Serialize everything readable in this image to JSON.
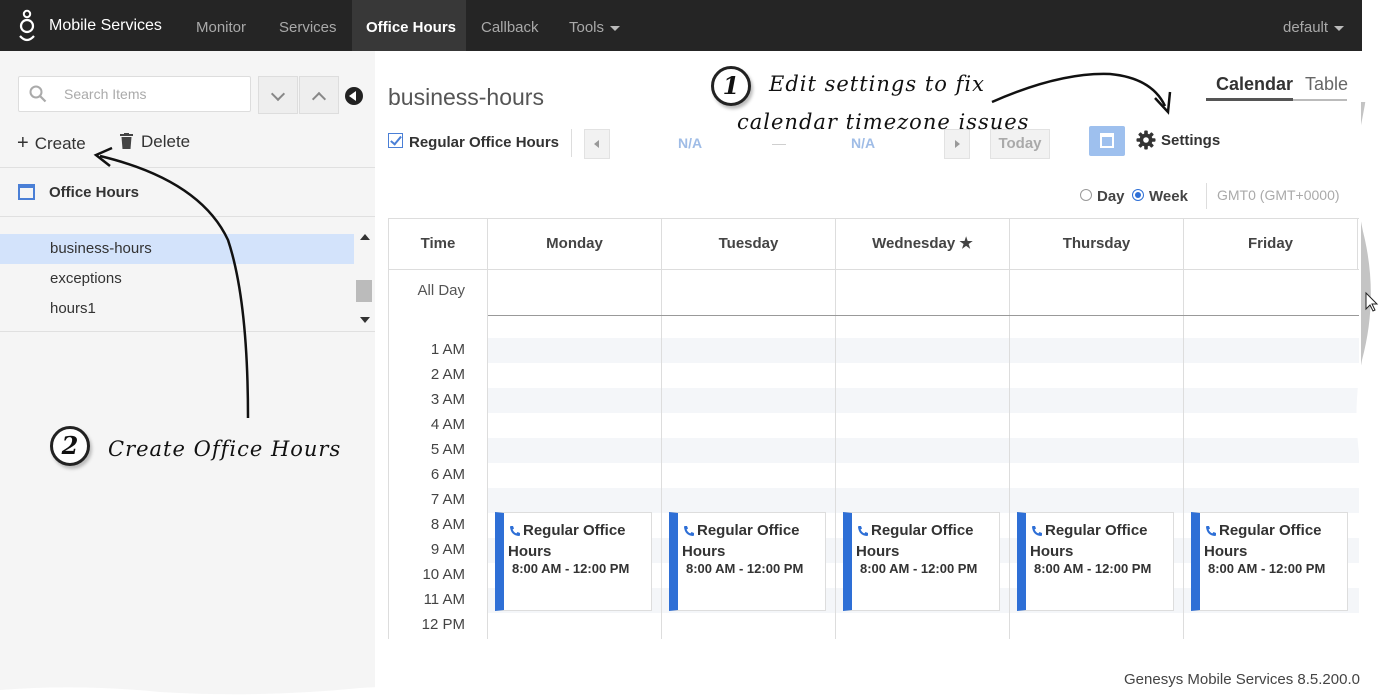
{
  "app": {
    "brand": "Mobile Services",
    "user_menu": "default"
  },
  "nav": {
    "items": [
      {
        "label": "Monitor"
      },
      {
        "label": "Services"
      },
      {
        "label": "Office Hours"
      },
      {
        "label": "Callback"
      },
      {
        "label": "Tools"
      }
    ],
    "active": "Office Hours"
  },
  "sidebar": {
    "search_placeholder": "Search Items",
    "create_label": "Create",
    "delete_label": "Delete",
    "section_title": "Office Hours",
    "items": [
      {
        "label": "business-hours",
        "selected": true
      },
      {
        "label": "exceptions",
        "selected": false
      },
      {
        "label": "hours1",
        "selected": false
      }
    ]
  },
  "main": {
    "title": "business-hours",
    "view_tabs": [
      {
        "label": "Calendar",
        "active": true
      },
      {
        "label": "Table",
        "active": false
      }
    ],
    "regular_hours_label": "Regular Office Hours",
    "regular_hours_checked": true,
    "range_start": "N/A",
    "range_sep": "—",
    "range_end": "N/A",
    "today_label": "Today",
    "settings_label": "Settings",
    "view_day_label": "Day",
    "view_week_label": "Week",
    "selected_view": "Week",
    "timezone": "GMT0 (GMT+0000)"
  },
  "calendar": {
    "time_header": "Time",
    "all_day_label": "All Day",
    "days": [
      {
        "label": "Monday"
      },
      {
        "label": "Tuesday"
      },
      {
        "label": "Wednesday ★"
      },
      {
        "label": "Thursday"
      },
      {
        "label": "Friday"
      }
    ],
    "hours": [
      "1 AM",
      "2 AM",
      "3 AM",
      "4 AM",
      "5 AM",
      "6 AM",
      "7 AM",
      "8 AM",
      "9 AM",
      "10 AM",
      "11 AM",
      "12 PM"
    ],
    "event": {
      "title": "Regular Office Hours",
      "time": "8:00 AM - 12:00 PM"
    }
  },
  "footer": {
    "text": "Genesys Mobile Services 8.5.200.0"
  },
  "annotations": {
    "one_number": "1",
    "one_line1": "Edit settings to fix",
    "one_line2": "calendar timezone issues",
    "two_number": "2",
    "two_text": "Create Office Hours"
  },
  "colors": {
    "nav_bg": "#252525",
    "accent": "#2e6fd6",
    "selected_row": "#d3e3fb",
    "sidebar_bg": "#f5f5f5"
  }
}
